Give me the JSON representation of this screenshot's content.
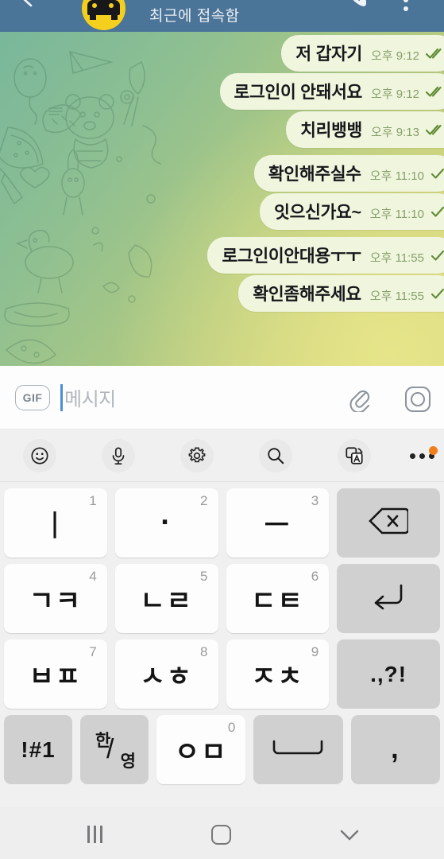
{
  "header": {
    "title": "최근에 접속함",
    "back_icon": "back-arrow-icon",
    "avatar_icon": "car-avatar-icon",
    "video_icon": "video-call-icon",
    "call_icon": "phone-call-icon",
    "menu_icon": "overflow-menu-icon",
    "bg_color": "#4a7498"
  },
  "chat": {
    "bubble_color": "#f0f5de",
    "meta_color": "#87a06b",
    "groups": [
      {
        "messages": [
          {
            "text": "저 갑자기",
            "time": "오후 9:12",
            "ticks": 2
          },
          {
            "text": "로그인이 안돼서요",
            "time": "오후 9:12",
            "ticks": 2
          },
          {
            "text": "치리뱅뱅",
            "time": "오후 9:13",
            "ticks": 2
          }
        ]
      },
      {
        "messages": [
          {
            "text": "확인해주실수",
            "time": "오후 11:10",
            "ticks": 1
          },
          {
            "text": "잇으신가요~",
            "time": "오후 11:10",
            "ticks": 1
          }
        ]
      },
      {
        "messages": [
          {
            "text": "로그인이안대용ㅜㅜ",
            "time": "오후 11:55",
            "ticks": 1
          },
          {
            "text": "확인좀해주세요",
            "time": "오후 11:55",
            "ticks": 1
          }
        ]
      }
    ]
  },
  "input_bar": {
    "gif_label": "GIF",
    "placeholder": "메시지",
    "value": "",
    "attach_icon": "paperclip-icon",
    "camera_icon": "camera-icon"
  },
  "keyboard_toolbar": {
    "items": [
      {
        "icon": "emoji-smiley-icon"
      },
      {
        "icon": "microphone-icon"
      },
      {
        "icon": "gear-settings-icon"
      },
      {
        "icon": "search-icon"
      },
      {
        "icon": "translate-icon"
      },
      {
        "icon": "more-options-icon",
        "badge": true
      }
    ],
    "badge_color": "#f27e1a"
  },
  "keyboard": {
    "rows": [
      [
        {
          "glyph": "ㅣ",
          "num": "1",
          "type": "char"
        },
        {
          "glyph": "·",
          "num": "2",
          "type": "char"
        },
        {
          "glyph": "ㅡ",
          "num": "3",
          "type": "char"
        },
        {
          "glyph": "",
          "num": "",
          "type": "backspace",
          "name": "backspace-key"
        }
      ],
      [
        {
          "glyph": "ㄱㅋ",
          "num": "4",
          "type": "char"
        },
        {
          "glyph": "ㄴㄹ",
          "num": "5",
          "type": "char"
        },
        {
          "glyph": "ㄷㅌ",
          "num": "6",
          "type": "char"
        },
        {
          "glyph": "",
          "num": "",
          "type": "enter",
          "name": "enter-key"
        }
      ],
      [
        {
          "glyph": "ㅂㅍ",
          "num": "7",
          "type": "char"
        },
        {
          "glyph": "ㅅㅎ",
          "num": "8",
          "type": "char"
        },
        {
          "glyph": "ㅈㅊ",
          "num": "9",
          "type": "char"
        },
        {
          "glyph": ".,?!",
          "num": "",
          "type": "fn",
          "name": "punctuation-key"
        }
      ],
      [
        {
          "glyph": "!#1",
          "num": "",
          "type": "sym",
          "name": "symbols-key"
        },
        {
          "glyph": "한/영",
          "num": "",
          "type": "lang",
          "name": "language-toggle-key"
        },
        {
          "glyph": "ㅇㅁ",
          "num": "0",
          "type": "char"
        },
        {
          "glyph": "",
          "num": "",
          "type": "space",
          "name": "space-key"
        },
        {
          "glyph": ",",
          "num": "",
          "type": "fn",
          "name": "comma-key"
        }
      ]
    ]
  },
  "nav_bar": {
    "recents_icon": "recents-icon",
    "home_icon": "home-icon",
    "hide_keyboard_icon": "chevron-down-icon"
  }
}
